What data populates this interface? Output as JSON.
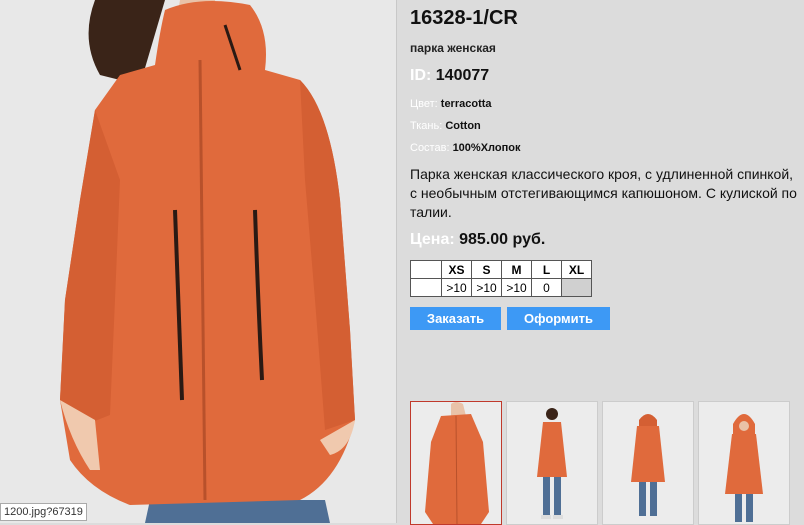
{
  "product": {
    "sku": "16328-1/CR",
    "type": "парка женская",
    "id_label": "ID:",
    "id_value": "140077",
    "color_label": "Цвет:",
    "color_value": "terracotta",
    "fabric_label": "Ткань:",
    "fabric_value": "Cotton",
    "composition_label": "Состав:",
    "composition_value": "100%Хлопок",
    "description": "Парка женская классического кроя, с удлиненной спинкой, с необычным отстегивающимся капюшоном. С кулиской по талии.",
    "price_label": "Цена:",
    "price_value": "985.00 руб."
  },
  "sizes": {
    "headers": [
      "",
      "XS",
      "S",
      "M",
      "L",
      "XL"
    ],
    "stock": [
      "",
      ">10",
      ">10",
      ">10",
      "0",
      ""
    ]
  },
  "buttons": {
    "order": "Заказать",
    "checkout": "Оформить"
  },
  "status_url": "1200.jpg?67319",
  "colors": {
    "accent": "#3d99f5",
    "coat": "#e06a3c",
    "jeans": "#4f6f95"
  }
}
